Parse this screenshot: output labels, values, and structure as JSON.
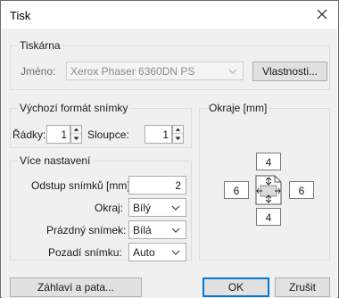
{
  "window": {
    "title": "Tisk"
  },
  "printer": {
    "legend": "Tiskárna",
    "name_label": "Jméno:",
    "name_value": "Xerox Phaser 6360DN PS",
    "properties_button": "Vlastnosti..."
  },
  "format": {
    "legend": "Výchozí formát snímky",
    "rows_label": "Řádky:",
    "rows_value": "1",
    "columns_label": "Sloupce:",
    "columns_value": "1"
  },
  "more": {
    "legend": "Více nastavení",
    "gap_label": "Odstup snímků [mm]:",
    "gap_value": "2",
    "border_label": "Okraj:",
    "border_value": "Bílý",
    "empty_label": "Prázdný snímek:",
    "empty_value": "Bílá",
    "background_label": "Pozadí snímku:",
    "background_value": "Auto"
  },
  "margins": {
    "legend": "Okraje [mm]",
    "top": "4",
    "left": "6",
    "right": "6",
    "bottom": "4"
  },
  "footer": {
    "header_footer_button": "Záhlaví a pata...",
    "ok_button": "OK",
    "cancel_button": "Zrušit"
  }
}
